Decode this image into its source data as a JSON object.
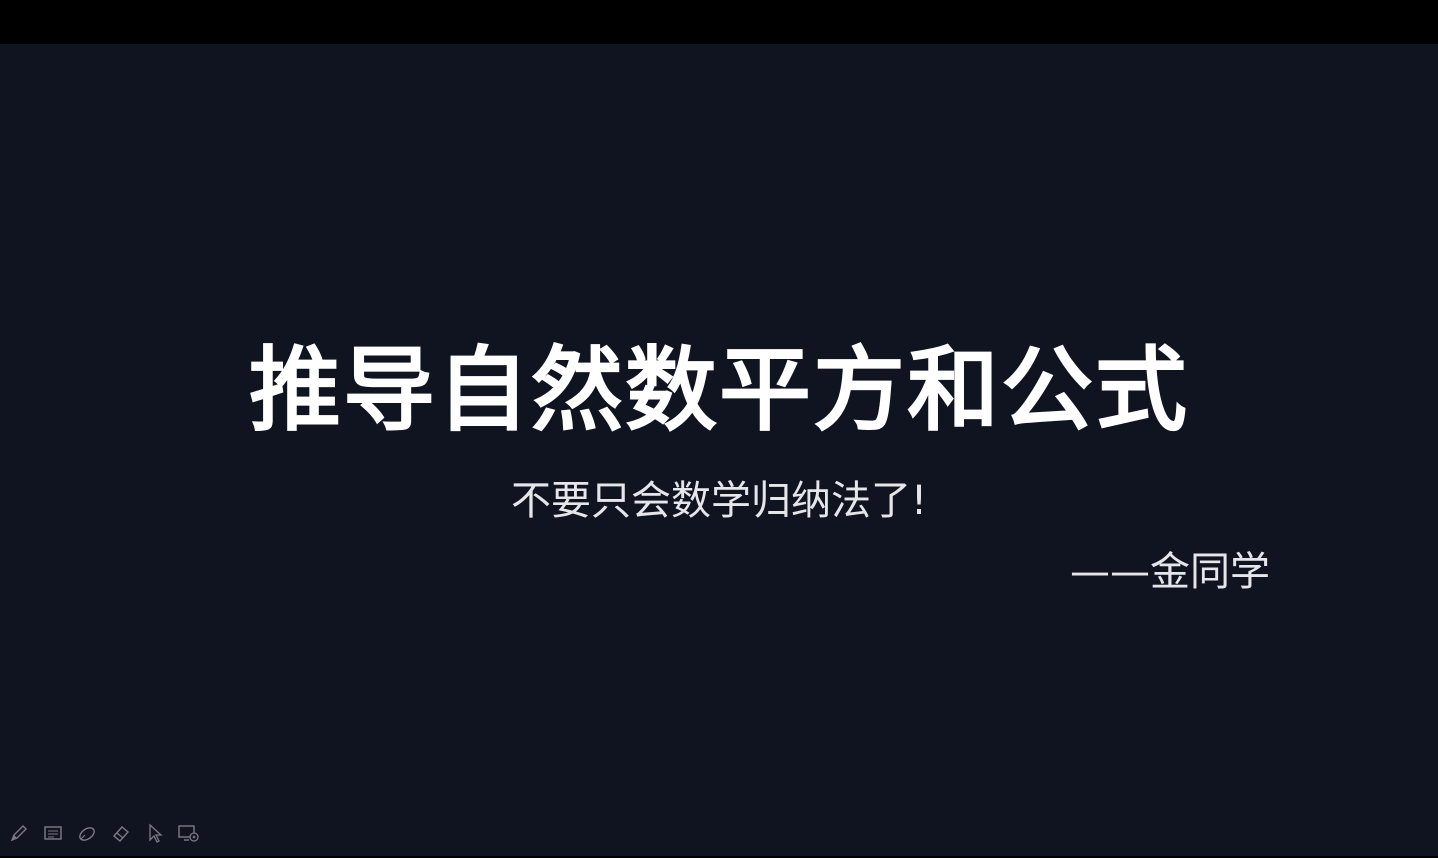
{
  "slide": {
    "title": "推导自然数平方和公式",
    "subtitle": "不要只会数学归纳法了!",
    "author": "——金同学"
  },
  "toolbar": {
    "tools": [
      {
        "name": "pen-icon"
      },
      {
        "name": "slides-icon"
      },
      {
        "name": "highlighter-icon"
      },
      {
        "name": "eraser-icon"
      },
      {
        "name": "pointer-icon"
      },
      {
        "name": "screen-settings-icon"
      }
    ]
  }
}
